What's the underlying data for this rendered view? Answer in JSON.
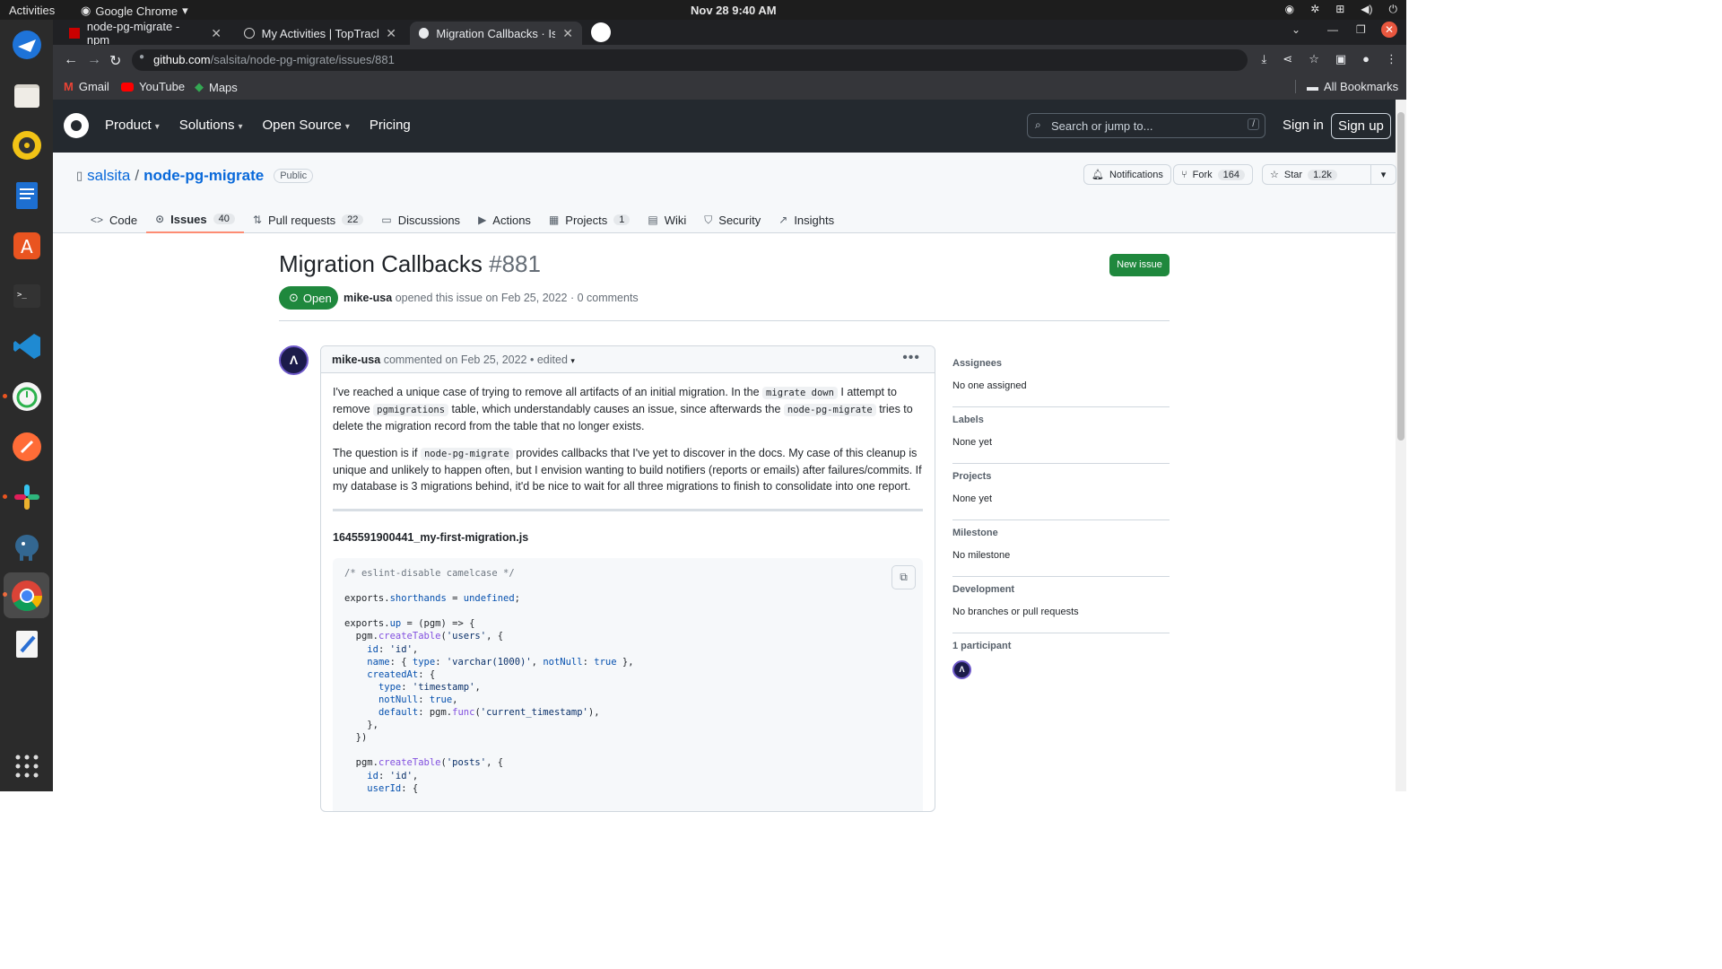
{
  "os": {
    "activities": "Activities",
    "app_name": "Google Chrome",
    "clock": "Nov 28  9:40 AM"
  },
  "browser": {
    "tabs": [
      {
        "title": "node-pg-migrate - npm"
      },
      {
        "title": "My Activities | TopTracker"
      },
      {
        "title": "Migration Callbacks · Issu"
      }
    ],
    "url_host": "github.com",
    "url_path": "/salsita/node-pg-migrate/issues/881",
    "bookmarks": [
      "Gmail",
      "YouTube",
      "Maps"
    ],
    "all_bookmarks": "All Bookmarks"
  },
  "gh": {
    "nav": [
      "Product",
      "Solutions",
      "Open Source",
      "Pricing"
    ],
    "search_placeholder": "Search or jump to...",
    "search_kbd": "/",
    "sign_in": "Sign in",
    "sign_up": "Sign up"
  },
  "repo": {
    "owner": "salsita",
    "sep": "/",
    "name": "node-pg-migrate",
    "visibility": "Public",
    "notifications": "Notifications",
    "fork_label": "Fork",
    "fork_count": "164",
    "star_label": "Star",
    "star_count": "1.2k",
    "tabs": [
      {
        "label": "Code",
        "count": ""
      },
      {
        "label": "Issues",
        "count": "40"
      },
      {
        "label": "Pull requests",
        "count": "22"
      },
      {
        "label": "Discussions",
        "count": ""
      },
      {
        "label": "Actions",
        "count": ""
      },
      {
        "label": "Projects",
        "count": "1"
      },
      {
        "label": "Wiki",
        "count": ""
      },
      {
        "label": "Security",
        "count": ""
      },
      {
        "label": "Insights",
        "count": ""
      }
    ]
  },
  "issue": {
    "title": "Migration Callbacks",
    "number": "#881",
    "new_issue": "New issue",
    "state": "Open",
    "author": "mike-usa",
    "opened_text": "opened this issue on Feb 25, 2022 · 0 comments"
  },
  "comment": {
    "author": "mike-usa",
    "meta": "commented on Feb 25, 2022 • edited",
    "p1_a": "I've reached a unique case of trying to remove all artifacts of an initial migration. In the",
    "p1_code1": "migrate down",
    "p1_b": "I attempt to remove",
    "p1_code2": "pgmigrations",
    "p1_c": "table, which understandably causes an issue, since afterwards the",
    "p1_code3": "node-pg-migrate",
    "p1_d": "tries to delete the migration record from the table that no longer exists.",
    "p2_a": "The question is if",
    "p2_code": "node-pg-migrate",
    "p2_b": "provides callbacks that I've yet to discover in the docs. My case of this cleanup is unique and unlikely to happen often, but I envision wanting to build notifiers (reports or emails) after failures/commits. If my database is 3 migrations behind, it'd be nice to wait for all three migrations to finish to consolidate into one report.",
    "filename": "1645591900441_my-first-migration.js",
    "code_lines": [
      "/* eslint-disable camelcase */",
      "",
      "exports.shorthands = undefined;",
      "",
      "exports.up = (pgm) => {",
      "  pgm.createTable('users', {",
      "    id: 'id',",
      "    name: { type: 'varchar(1000)', notNull: true },",
      "    createdAt: {",
      "      type: 'timestamp',",
      "      notNull: true,",
      "      default: pgm.func('current_timestamp'),",
      "    },",
      "  })",
      "",
      "  pgm.createTable('posts', {",
      "    id: 'id',",
      "    userId: {"
    ]
  },
  "sidebar": [
    {
      "heading": "Assignees",
      "value": "No one assigned"
    },
    {
      "heading": "Labels",
      "value": "None yet"
    },
    {
      "heading": "Projects",
      "value": "None yet"
    },
    {
      "heading": "Milestone",
      "value": "No milestone"
    },
    {
      "heading": "Development",
      "value": "No branches or pull requests"
    },
    {
      "heading": "1 participant",
      "value": ""
    }
  ],
  "colors": {
    "github_header": "#24292f",
    "open_green": "#1f883d",
    "link_blue": "#0969da",
    "tab_underline": "#fd8c73"
  }
}
